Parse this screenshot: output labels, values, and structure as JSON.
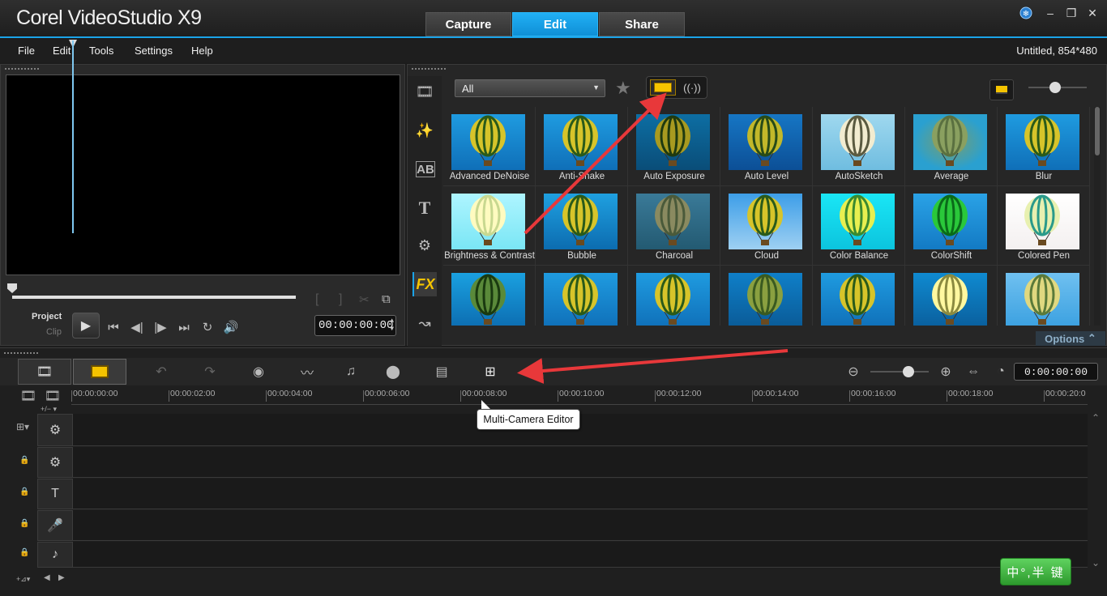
{
  "app": {
    "title": "Corel VideoStudio X9",
    "tabs": [
      {
        "label": "Capture",
        "active": false
      },
      {
        "label": "Edit",
        "active": true
      },
      {
        "label": "Share",
        "active": false
      }
    ],
    "window_buttons": [
      "help-icon",
      "minimize-icon",
      "restore-icon",
      "close-icon"
    ]
  },
  "menu": {
    "items": [
      "File",
      "Edit",
      "Tools",
      "Settings",
      "Help"
    ],
    "project_info": "Untitled, 854*480"
  },
  "player": {
    "mode_project": "Project",
    "mode_clip": "Clip",
    "timecode": "00:00:00:00"
  },
  "library": {
    "filter": "All",
    "options_label": "Options",
    "effects": [
      {
        "name": "Advanced DeNoise",
        "style": "normal"
      },
      {
        "name": "Anti-Shake",
        "style": "normal"
      },
      {
        "name": "Auto Exposure",
        "style": "dark"
      },
      {
        "name": "Auto Level",
        "style": "deep"
      },
      {
        "name": "AutoSketch",
        "style": "sketch"
      },
      {
        "name": "Average",
        "style": "blur"
      },
      {
        "name": "Blur",
        "style": "normal"
      },
      {
        "name": "Brightness & Contrast",
        "style": "bright"
      },
      {
        "name": "Bubble",
        "style": "bubble"
      },
      {
        "name": "Charcoal",
        "style": "charcoal"
      },
      {
        "name": "Cloud",
        "style": "cloud"
      },
      {
        "name": "Color Balance",
        "style": "cyan"
      },
      {
        "name": "ColorShift",
        "style": "green"
      },
      {
        "name": "Colored Pen",
        "style": "pen"
      },
      {
        "name": "",
        "style": "stripe"
      },
      {
        "name": "",
        "style": "normal"
      },
      {
        "name": "",
        "style": "normal"
      },
      {
        "name": "",
        "style": "dim"
      },
      {
        "name": "",
        "style": "normal"
      },
      {
        "name": "",
        "style": "flash"
      },
      {
        "name": "",
        "style": "sky"
      }
    ]
  },
  "timeline": {
    "timecode": "0:00:00:00",
    "ruler": [
      "00:00:00:00",
      "00:00:02:00",
      "00:00:04:00",
      "00:00:06:00",
      "00:00:08:00",
      "00:00:10:00",
      "00:00:12:00",
      "00:00:14:00",
      "00:00:16:00",
      "00:00:18:00",
      "00:00:20:0"
    ],
    "tooltip": "Multi-Camera Editor",
    "tracks": [
      {
        "name": "video-track",
        "icon": "film-reel-icon"
      },
      {
        "name": "overlay-track",
        "icon": "film-reel-icon"
      },
      {
        "name": "title-track",
        "icon": "title-icon"
      },
      {
        "name": "voice-track",
        "icon": "microphone-icon"
      },
      {
        "name": "music-track",
        "icon": "music-note-icon"
      }
    ]
  },
  "ime": {
    "label": "中°,半 键"
  },
  "colors": {
    "accent": "#1aa3e8",
    "highlight": "#f5c400",
    "annotation_arrow": "#e8383a"
  }
}
